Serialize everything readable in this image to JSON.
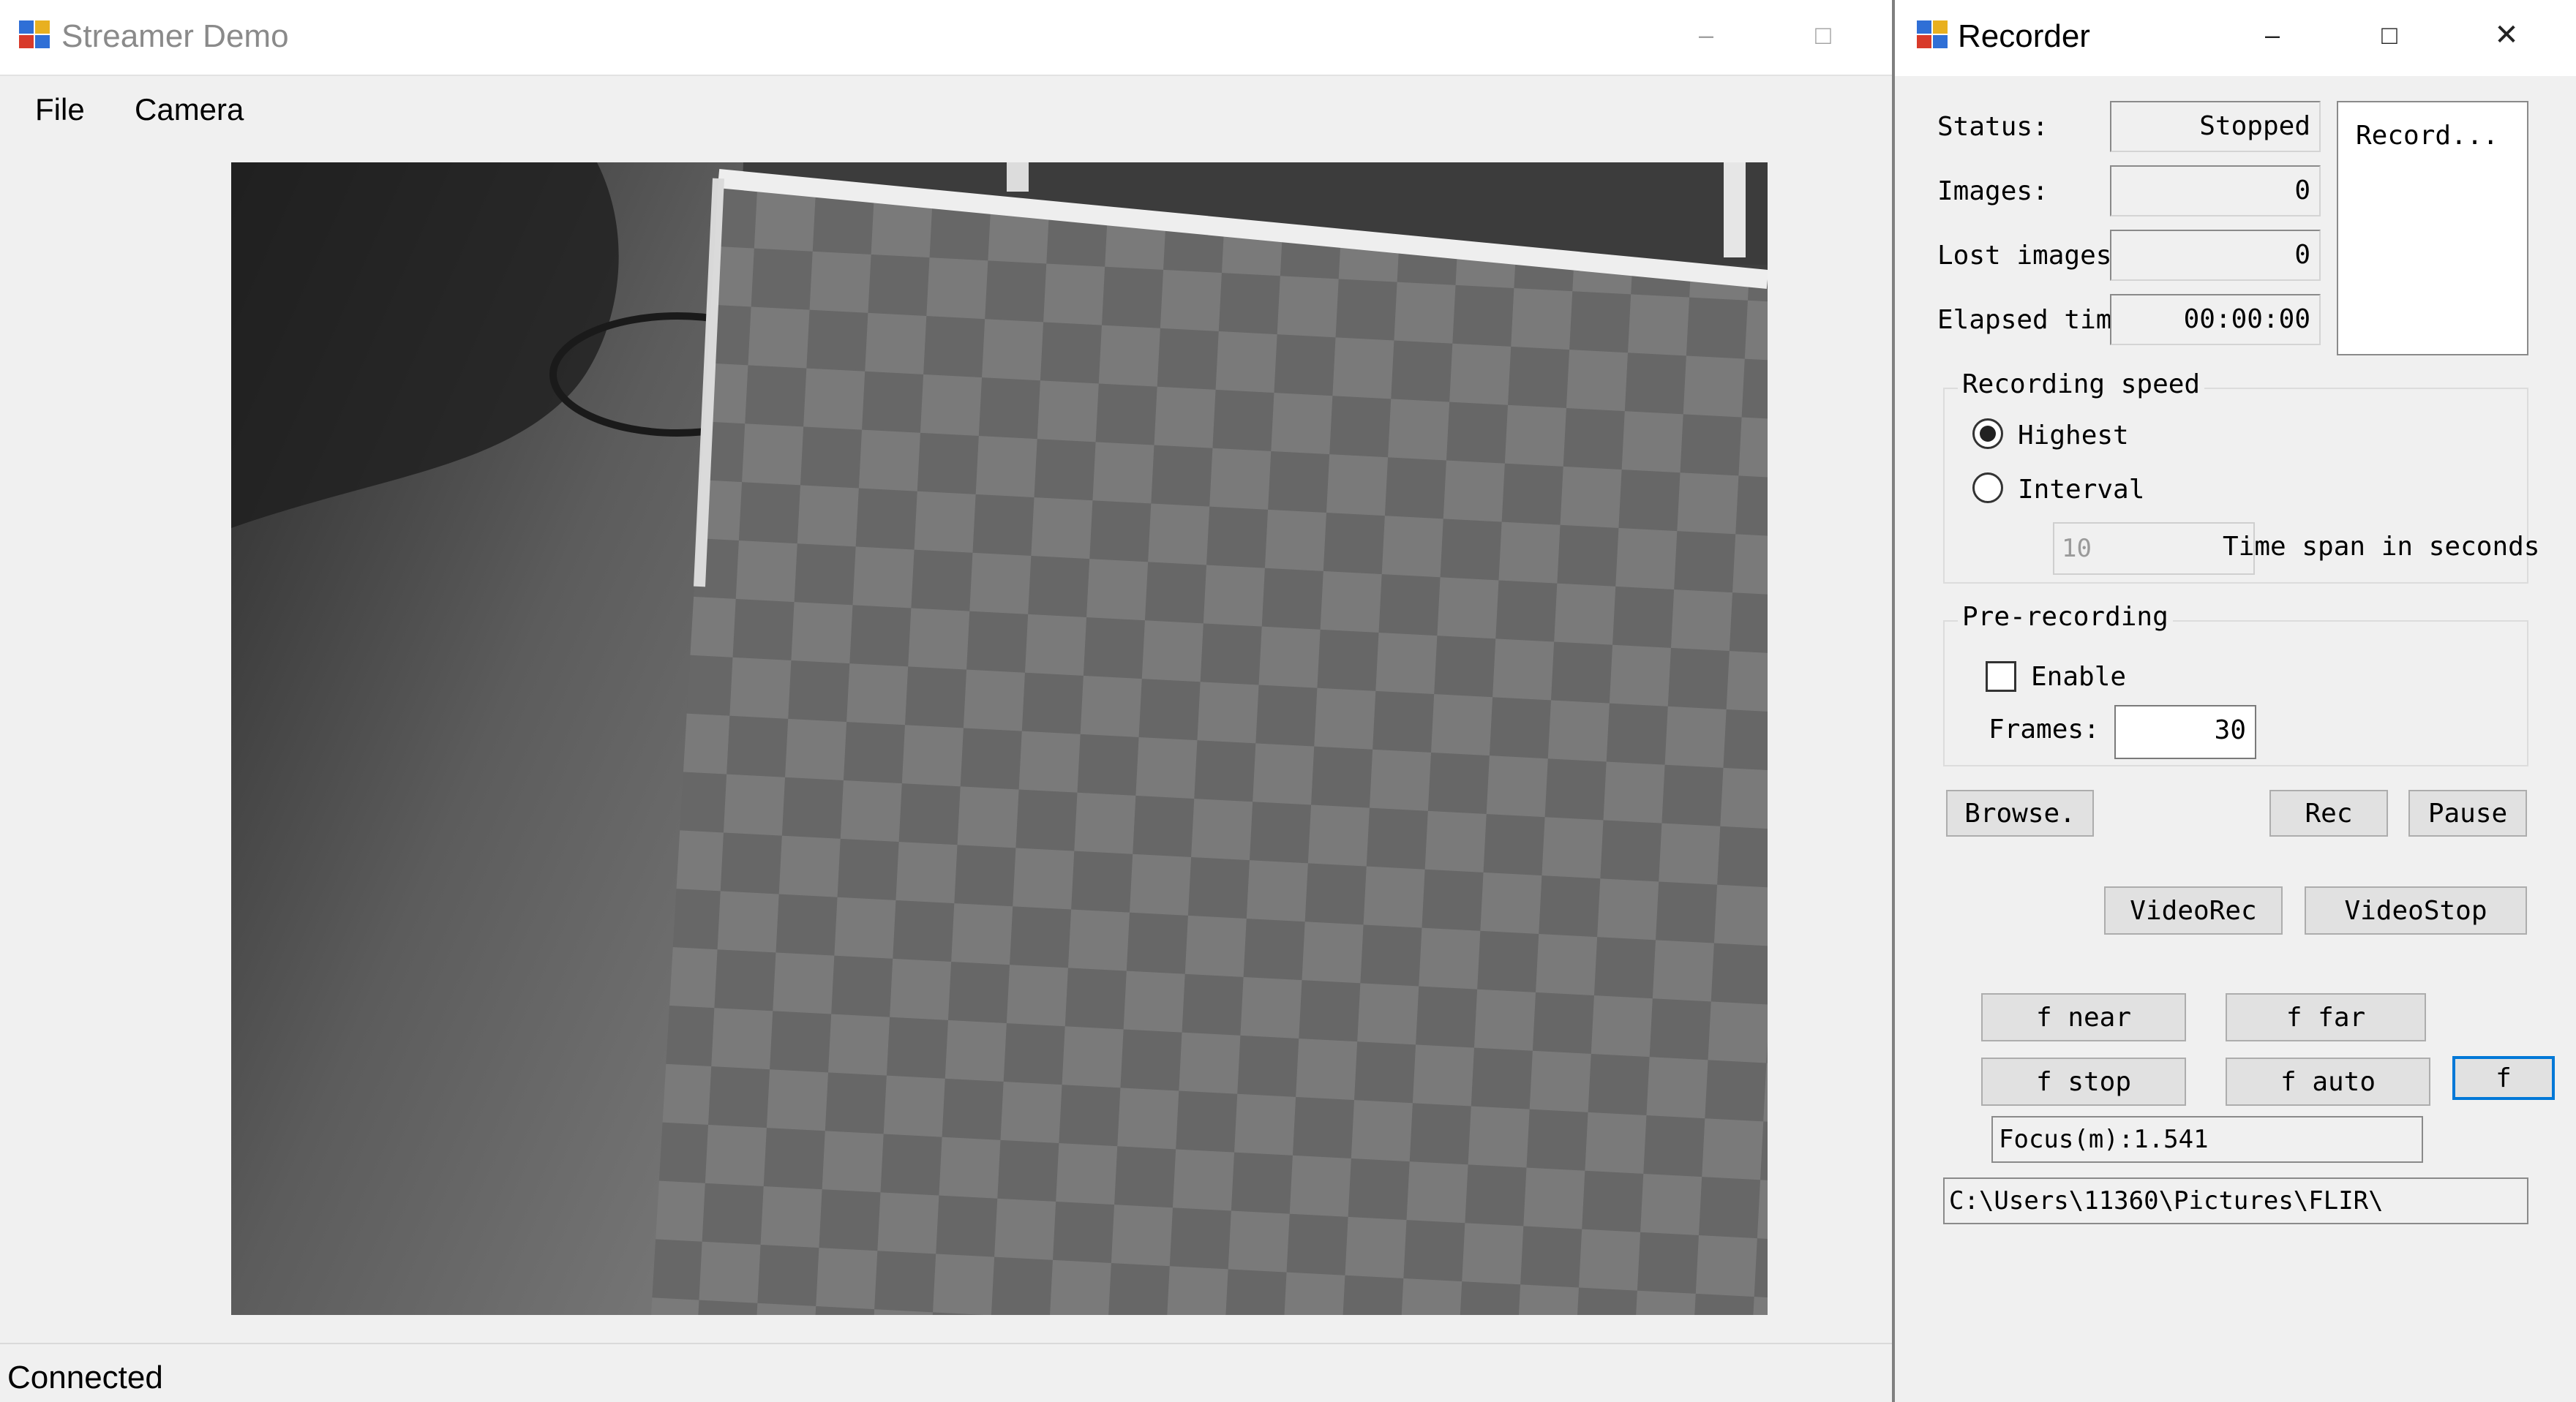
{
  "main_window": {
    "title": "Streamer Demo",
    "menu": [
      "File",
      "Camera"
    ],
    "status": "Connected"
  },
  "recorder": {
    "title": "Recorder",
    "status_label": "Status:",
    "status_value": "Stopped",
    "images_label": "Images:",
    "images_value": "0",
    "lost_label": "Lost images",
    "lost_value": "0",
    "elapsed_label": "Elapsed tim",
    "elapsed_value": "00:00:00",
    "record_list_item": "Record...",
    "speed_group": {
      "title": "Recording speed",
      "highest": "Highest",
      "interval": "Interval",
      "selected": "Highest",
      "interval_placeholder": "10",
      "timespan_label": "Time span in seconds"
    },
    "prerec_group": {
      "title": "Pre-recording",
      "enable_label": "Enable",
      "enabled": false,
      "frames_label": "Frames:",
      "frames_value": "30"
    },
    "buttons": {
      "browse": "Browse.",
      "rec": "Rec",
      "pause": "Pause",
      "videorec": "VideoRec",
      "videostop": "VideoStop",
      "f_near": "f near",
      "f_far": "f far",
      "f_stop": "f stop",
      "f_auto": "f auto",
      "f": "f"
    },
    "focus_text": "Focus(m):1.541",
    "path_text": "C:\\Users\\11360\\Pictures\\FLIR\\"
  }
}
